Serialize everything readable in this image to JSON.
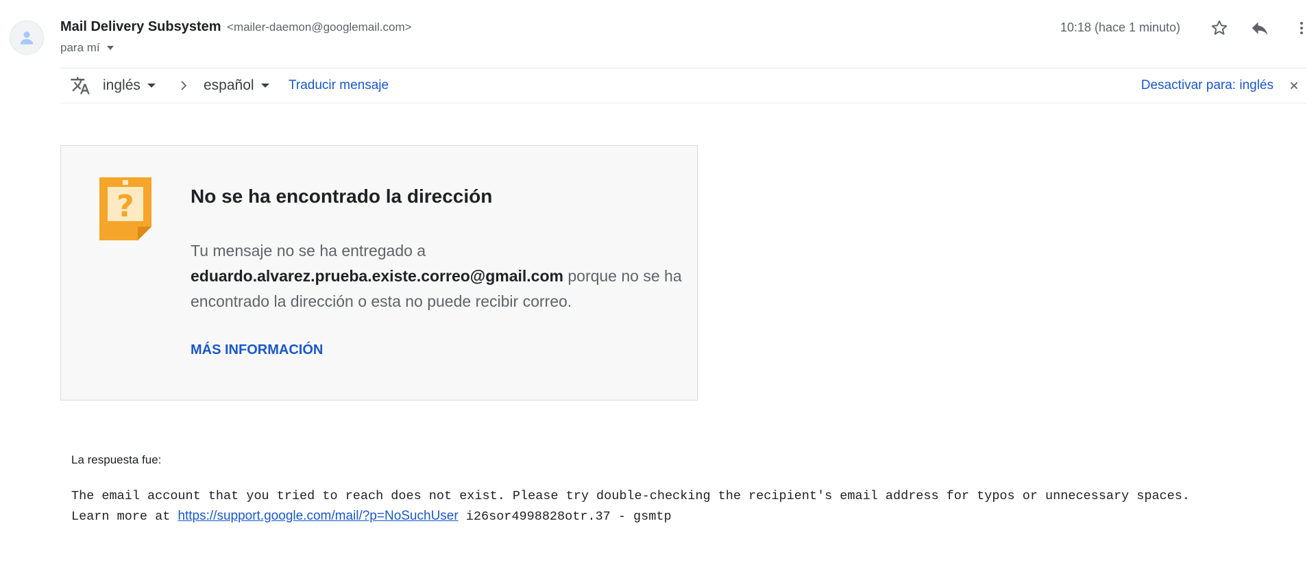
{
  "header": {
    "sender_name": "Mail Delivery Subsystem",
    "sender_email": "<mailer-daemon@googlemail.com>",
    "recipient_label": "para mí",
    "time": "10:18 (hace 1 minuto)",
    "icons": [
      "person-icon",
      "star-icon",
      "reply-icon",
      "more-vert-icon"
    ]
  },
  "translate_bar": {
    "source_lang": "inglés",
    "target_lang": "español",
    "translate_link": "Traducir mensaje",
    "disable_link": "Desactivar para: inglés",
    "icons": [
      "translate-icon",
      "chevron-right-icon",
      "close-icon"
    ]
  },
  "bounce_card": {
    "title": "No se ha encontrado la dirección",
    "text_before": "Tu mensaje no se ha entregado a",
    "address": "eduardo.alvarez.prueba.existe.correo@gmail.com",
    "text_after": "porque no se ha encontrado la dirección o esta no puede recibir correo.",
    "more_info": "MÁS INFORMACIÓN",
    "icon": "question-note-icon",
    "icon_color": "#f4a52a"
  },
  "response": {
    "label": "La respuesta fue:",
    "line1": "The email account that you tried to reach does not exist. Please try double-checking the recipient's email address for typos or unnecessary spaces.",
    "line2_prefix": "Learn more at",
    "link": "https://support.google.com/mail/?p=NoSuchUser",
    "line2_suffix": "i26sor4998828otr.37 - gsmtp"
  },
  "colors": {
    "link_blue": "#1a57c9",
    "text_dark": "#202124",
    "text_grey": "#5f6368",
    "card_bg": "#f8f8f8"
  }
}
